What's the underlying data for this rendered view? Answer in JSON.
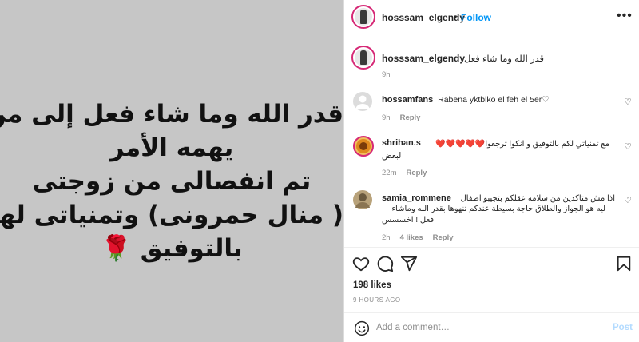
{
  "post": {
    "image_text_lines": [
      "قدر الله وما شاء فعل إلى من",
      "يهمه الأمر",
      "تم انفصالى من زوجتى",
      "( منال حمرونى) وتمنياتى لها",
      "بالتوفيق 🌹"
    ]
  },
  "header": {
    "username": "hosssam_elgendy",
    "dot": "•",
    "follow_label": "Follow",
    "more_label": "•••"
  },
  "caption": {
    "username": "hosssam_elgendy",
    "text": "قدر الله وما شاء فعل",
    "time": "9h"
  },
  "comments": [
    {
      "username": "hossamfans",
      "text": "Rabena yktblko el feh el 5er♡",
      "time": "9h",
      "likes": "",
      "reply": "Reply"
    },
    {
      "username": "shrihan.s",
      "text_line1": "مع تمنياتي لكم بالتوفيق و انكوا ترجعوا❤️❤️❤️❤️❤️",
      "text_line2": "لبعض",
      "time": "22m",
      "likes": "",
      "reply": "Reply"
    },
    {
      "username": "samia_rommene",
      "text_line1": "اذا مش متاكدين من سلامة عقلكم بتجيبو اطفال",
      "text_line2": "ليه هو الجواز والطلاق حاجة بسيطة عندكم تنهوها بقدر الله وماشاء",
      "text_line3": "فعل!! اخسسس",
      "time": "2h",
      "likes": "4 likes",
      "reply": "Reply"
    }
  ],
  "icons": {
    "like": "heart-icon",
    "comment": "comment-icon",
    "share": "share-icon",
    "save": "bookmark-icon",
    "emoji": "emoji-icon",
    "comment_like": "heart-icon"
  },
  "stats": {
    "likes": "198 likes",
    "time": "9 HOURS AGO"
  },
  "add_comment": {
    "placeholder": "Add a comment…",
    "post_label": "Post"
  },
  "colors": {
    "follow": "#0095f6",
    "post_disabled": "#b3dbff",
    "story_ring": "#d62976",
    "media_bg": "#c6c6c6"
  }
}
